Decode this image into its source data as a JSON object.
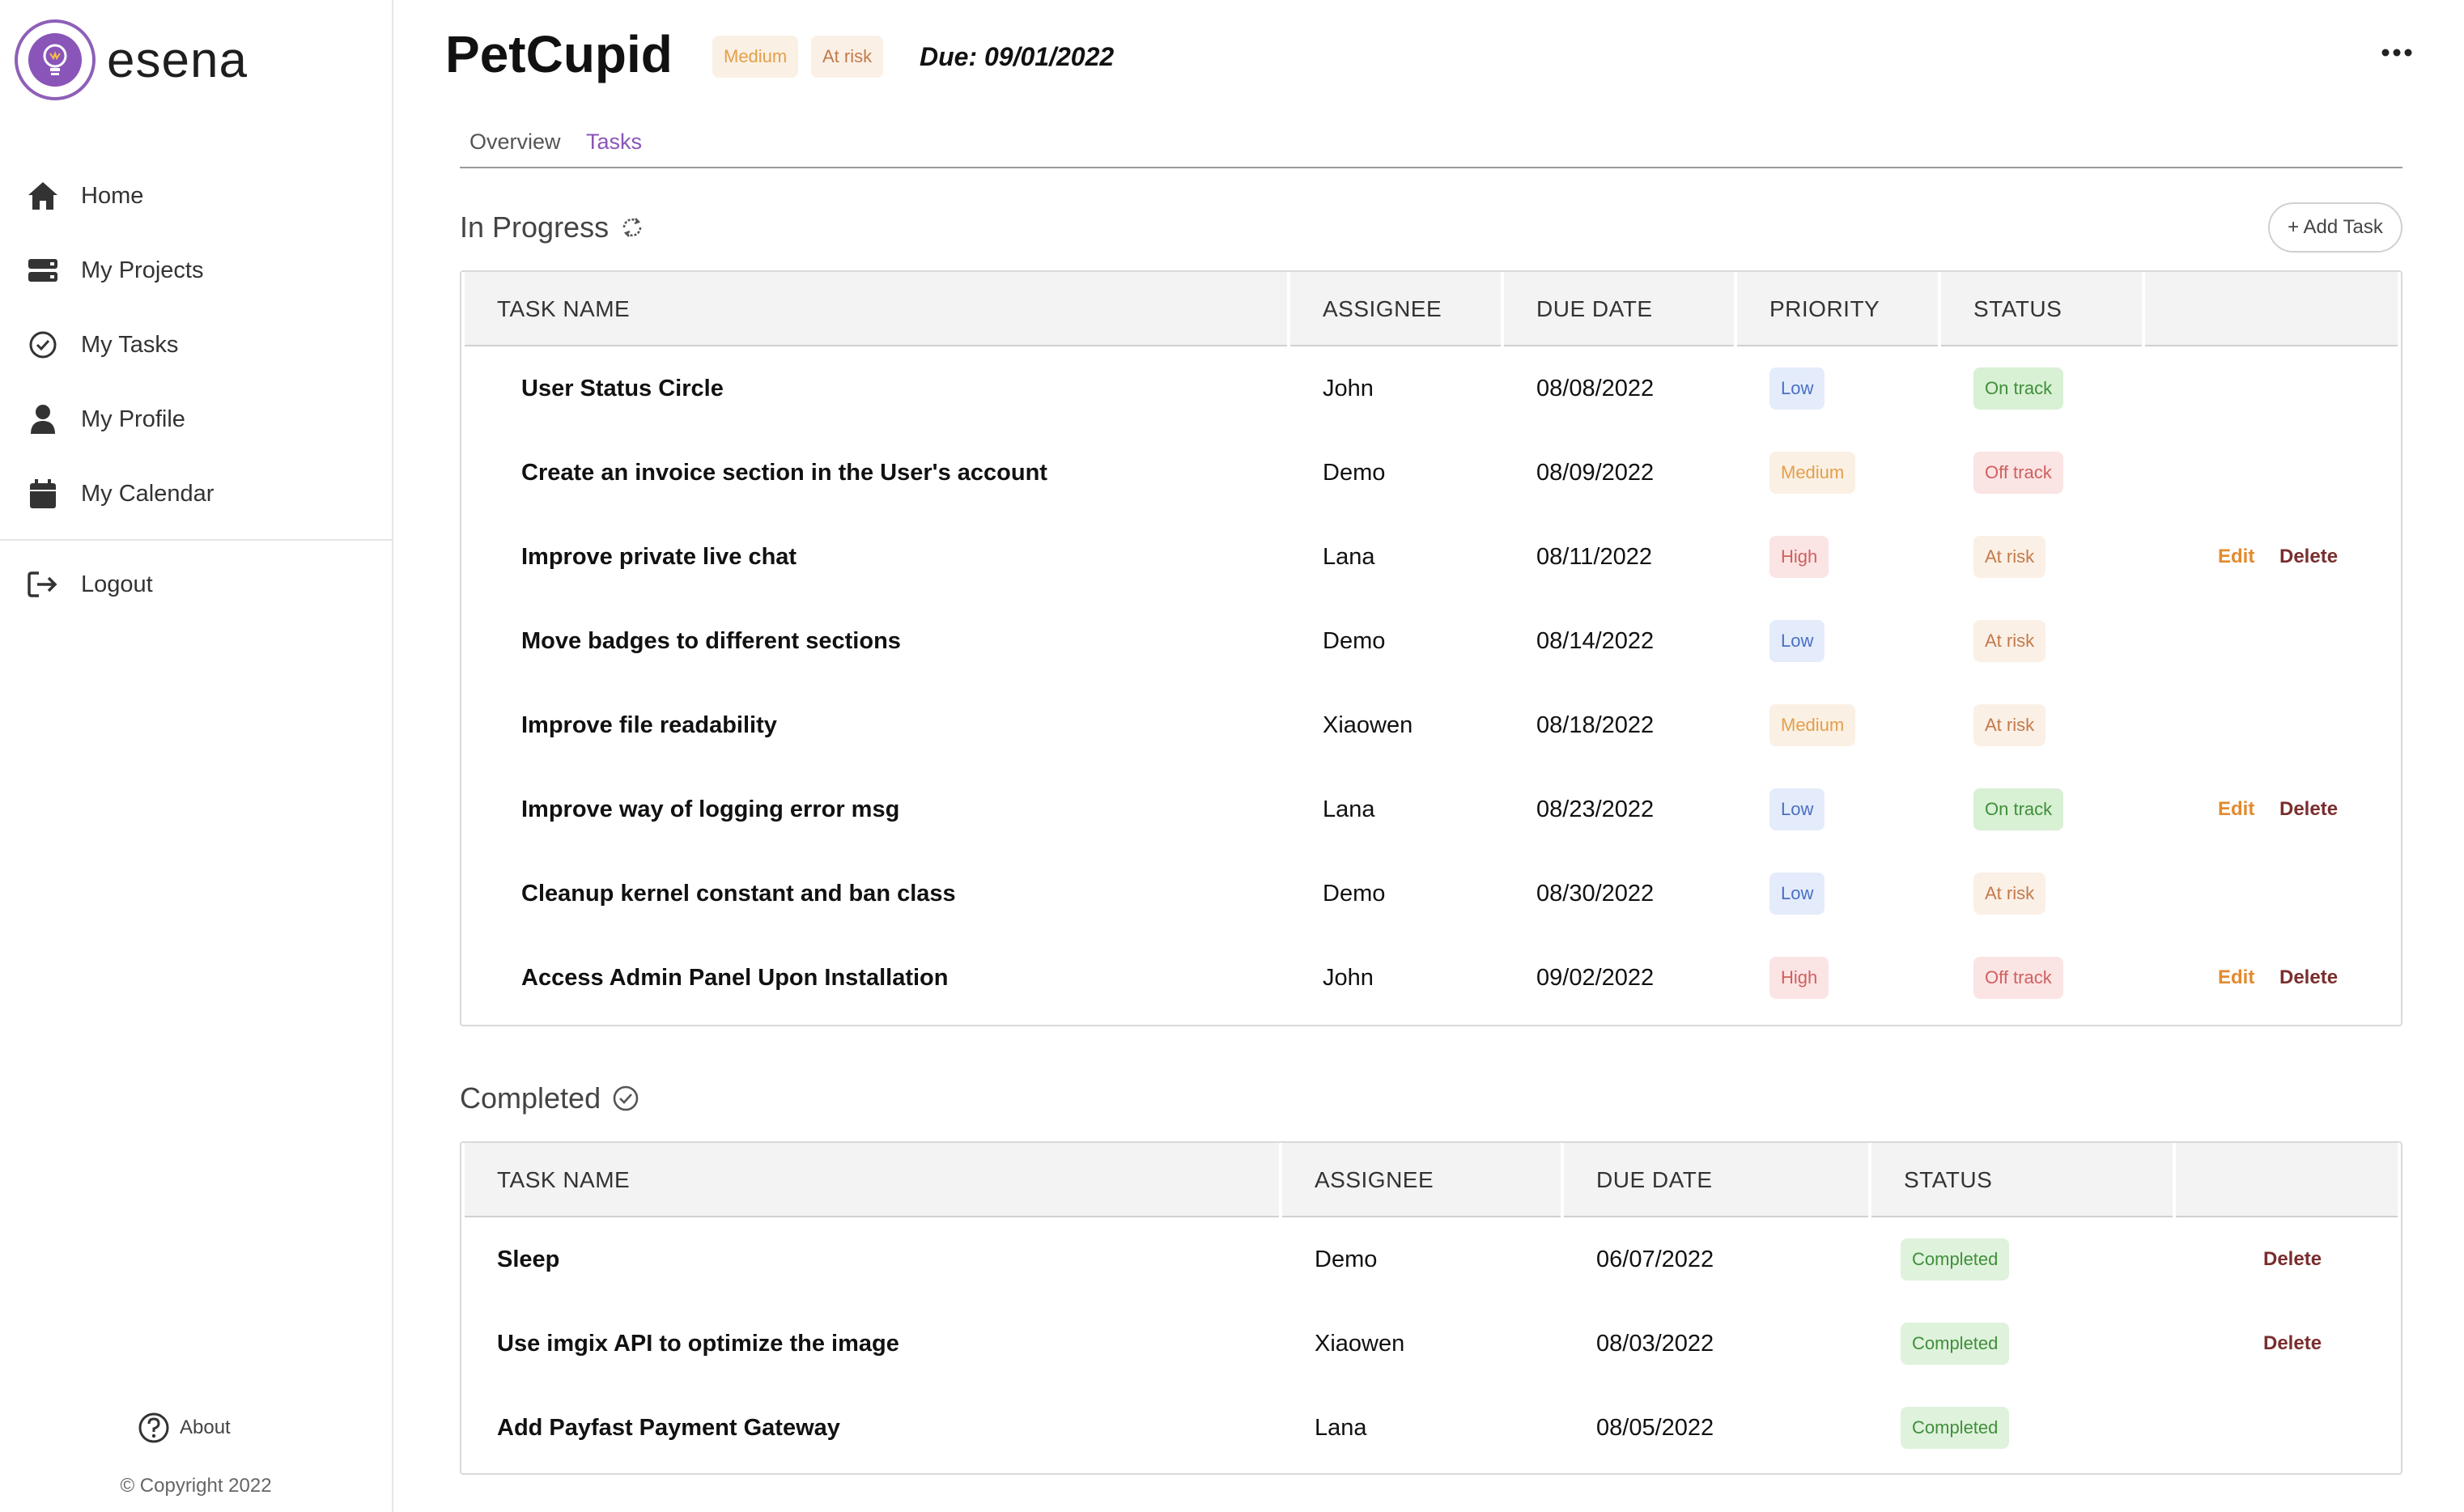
{
  "app": {
    "name": "esena"
  },
  "sidebar": {
    "items": [
      {
        "label": "Home",
        "icon": "home-icon"
      },
      {
        "label": "My Projects",
        "icon": "projects-icon"
      },
      {
        "label": "My Tasks",
        "icon": "check-circle-icon"
      },
      {
        "label": "My Profile",
        "icon": "user-icon"
      },
      {
        "label": "My Calendar",
        "icon": "calendar-icon"
      }
    ],
    "logout": "Logout",
    "about": "About",
    "copyright": "© Copyright 2022"
  },
  "project": {
    "title": "PetCupid",
    "priority_badge": "Medium",
    "status_badge": "At risk",
    "due": "Due: 09/01/2022"
  },
  "tabs": [
    "Overview",
    "Tasks"
  ],
  "active_tab": "Tasks",
  "in_progress": {
    "title": "In Progress",
    "add_task": "+ Add Task",
    "columns": [
      "TASK NAME",
      "ASSIGNEE",
      "DUE DATE",
      "PRIORITY",
      "STATUS"
    ],
    "rows": [
      {
        "name": "User Status Circle",
        "assignee": "John",
        "due": "08/08/2022",
        "priority": "Low",
        "status": "On track",
        "actions": false
      },
      {
        "name": "Create an invoice section in the User's account",
        "assignee": "Demo",
        "due": "08/09/2022",
        "priority": "Medium",
        "status": "Off track",
        "actions": false
      },
      {
        "name": "Improve private live chat",
        "assignee": "Lana",
        "due": "08/11/2022",
        "priority": "High",
        "status": "At risk",
        "actions": true
      },
      {
        "name": "Move badges to different sections",
        "assignee": "Demo",
        "due": "08/14/2022",
        "priority": "Low",
        "status": "At risk",
        "actions": false
      },
      {
        "name": "Improve file readability",
        "assignee": "Xiaowen",
        "due": "08/18/2022",
        "priority": "Medium",
        "status": "At risk",
        "actions": false
      },
      {
        "name": "Improve way of logging error msg",
        "assignee": "Lana",
        "due": "08/23/2022",
        "priority": "Low",
        "status": "On track",
        "actions": true
      },
      {
        "name": "Cleanup kernel constant and ban class",
        "assignee": "Demo",
        "due": "08/30/2022",
        "priority": "Low",
        "status": "At risk",
        "actions": false
      },
      {
        "name": "Access Admin Panel Upon Installation",
        "assignee": "John",
        "due": "09/02/2022",
        "priority": "High",
        "status": "Off track",
        "actions": true
      }
    ],
    "edit_label": "Edit",
    "delete_label": "Delete"
  },
  "completed": {
    "title": "Completed",
    "columns": [
      "TASK NAME",
      "ASSIGNEE",
      "DUE DATE",
      "STATUS"
    ],
    "rows": [
      {
        "name": "Sleep",
        "assignee": "Demo",
        "due": "06/07/2022",
        "status": "Completed",
        "deletable": true
      },
      {
        "name": "Use imgix API to optimize the image",
        "assignee": "Xiaowen",
        "due": "08/03/2022",
        "status": "Completed",
        "deletable": true
      },
      {
        "name": "Add Payfast Payment Gateway",
        "assignee": "Lana",
        "due": "08/05/2022",
        "status": "Completed",
        "deletable": false
      }
    ],
    "delete_label": "Delete"
  },
  "colors": {
    "accent": "#8a55b8",
    "Low": {
      "bg": "#e4ecfb",
      "fg": "#4a6fc4"
    },
    "Medium": {
      "bg": "#fbf0e4",
      "fg": "#e3a04a"
    },
    "High": {
      "bg": "#fbe4e4",
      "fg": "#d0605f"
    },
    "On track": {
      "bg": "#d8f0d4",
      "fg": "#3f8f3a"
    },
    "Off track": {
      "bg": "#fbe4e4",
      "fg": "#d0605f"
    },
    "At risk": {
      "bg": "#fbf0e6",
      "fg": "#c27a4a"
    },
    "Completed": {
      "bg": "#dff2dc",
      "fg": "#3f8f3a"
    }
  }
}
